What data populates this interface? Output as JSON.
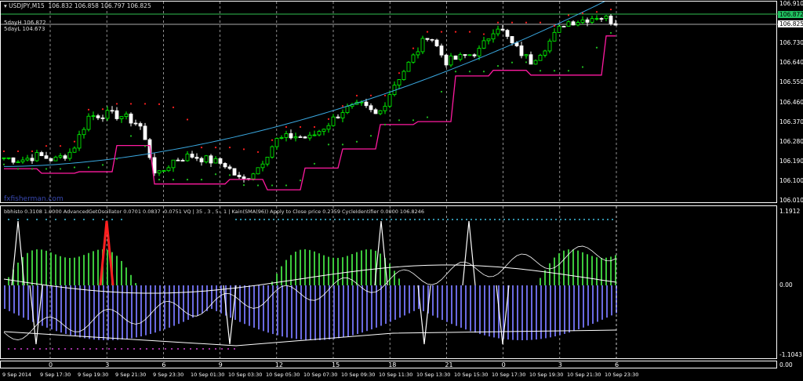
{
  "header": {
    "symbol": "USDJPY,M15",
    "ohlc": "106.832 106.858 106.797 106.825"
  },
  "labels": {
    "high": "5dayH 106.872",
    "low": "5dayL 104.673",
    "watermark": "fxfisherman.com"
  },
  "indicator_header": "bbhisto 0.3108 1.0000  AdvancedGetOscillator 0.0701 0.0837 -0.0751  VQ | 35 , 3 , 5 , 1 |   Kain(SMA(96)) Apply to Close price 0.2759  CycleIdentifier 0.0000 106.8246",
  "price_axis": [
    "106.910",
    "106.730",
    "106.640",
    "106.550",
    "106.460",
    "106.370",
    "106.280",
    "106.190",
    "106.100",
    "106.010"
  ],
  "badges": {
    "high": "106.872",
    "bid": "106.825"
  },
  "ind_axis": {
    "top": "1.1912",
    "mid": "0.00",
    "bottom": "-1.1043",
    "sub": "0.00"
  },
  "hours": [
    "0",
    "3",
    "6",
    "9",
    "12",
    "15",
    "18",
    "21",
    "0",
    "3",
    "6"
  ],
  "dates": [
    "9 Sep 2014",
    "9 Sep 17:30",
    "9 Sep 19:30",
    "9 Sep 21:30",
    "9 Sep 23:30",
    "10 Sep 01:30",
    "10 Sep 03:30",
    "10 Sep 05:30",
    "10 Sep 07:30",
    "10 Sep 09:30",
    "10 Sep 11:30",
    "10 Sep 13:30",
    "10 Sep 15:30",
    "10 Sep 17:30",
    "10 Sep 19:30",
    "10 Sep 21:30",
    "10 Sep 23:30"
  ],
  "colors": {
    "up": "#00ff00",
    "down": "#ffffff",
    "ma": "#3aa8e0",
    "channel": "#ff1aa0",
    "resist": "#ff2020",
    "support": "#20c020",
    "hist_green": "#3cc83c",
    "hist_blue": "#6a6ae0"
  },
  "chart_data": {
    "type": "candlestick",
    "price_range": [
      106.01,
      106.91
    ],
    "close_path": [
      106.21,
      106.2,
      106.22,
      106.2,
      106.24,
      106.4,
      106.41,
      106.4,
      106.36,
      106.12,
      106.2,
      106.22,
      106.2,
      106.18,
      106.1,
      106.17,
      106.29,
      106.31,
      106.3,
      106.36,
      106.43,
      106.45,
      106.4,
      106.55,
      106.66,
      106.78,
      106.65,
      106.67,
      106.7,
      106.82,
      106.72,
      106.65,
      106.73,
      106.83,
      106.84,
      106.86,
      106.83
    ]
  }
}
